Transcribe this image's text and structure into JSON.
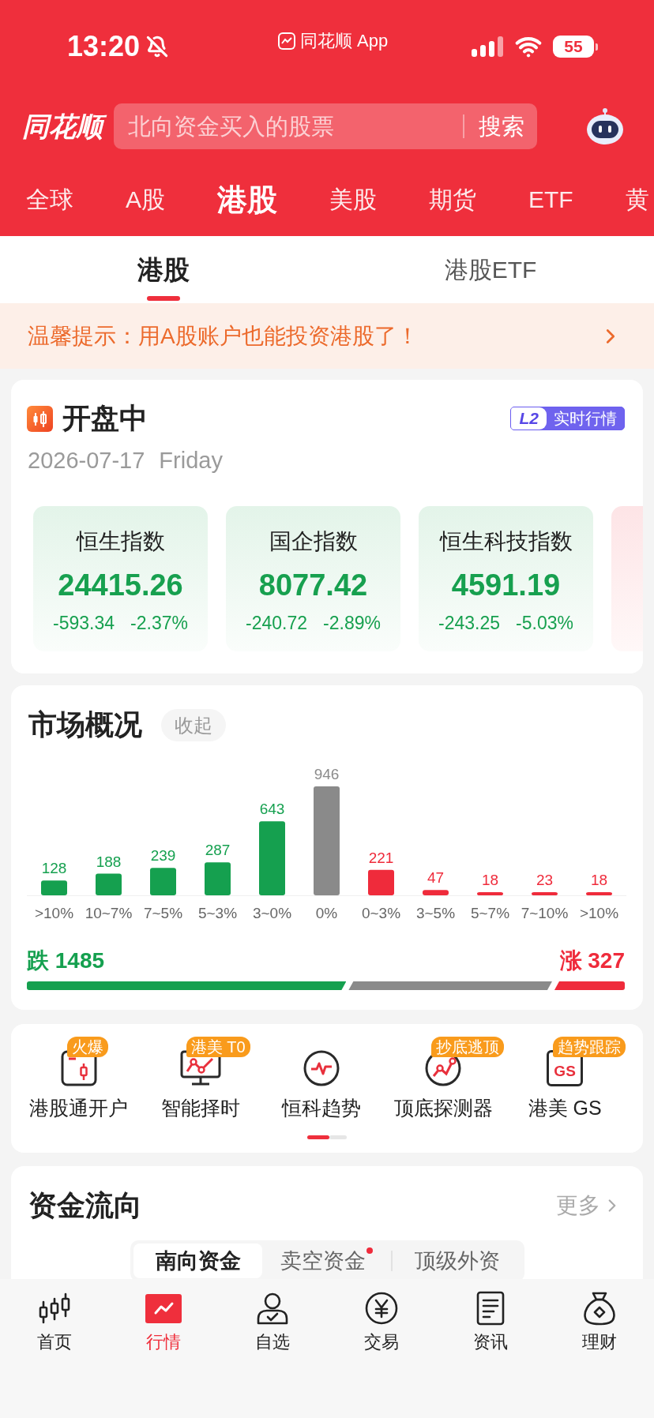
{
  "status_bar": {
    "time": "13:20",
    "app_name": "同花顺 App",
    "battery": "55"
  },
  "header": {
    "logo": "同花顺",
    "search": {
      "placeholder": "北向资金买入的股票",
      "button": "搜索"
    }
  },
  "market_tabs": [
    {
      "label": "全球",
      "selected": false
    },
    {
      "label": "A股",
      "selected": false
    },
    {
      "label": "港股",
      "selected": true
    },
    {
      "label": "美股",
      "selected": false
    },
    {
      "label": "期货",
      "selected": false
    },
    {
      "label": "ETF",
      "selected": false
    },
    {
      "label": "黄",
      "selected": false
    }
  ],
  "sub_tabs": [
    {
      "label": "港股",
      "selected": true
    },
    {
      "label": "港股ETF",
      "selected": false
    }
  ],
  "notice": {
    "text": "温馨提示：用A股账户也能投资港股了！"
  },
  "session": {
    "status": "开盘中",
    "date": "2026-07-17",
    "weekday": "Friday",
    "badge": {
      "tag": "L2",
      "label": "实时行情"
    }
  },
  "indices": [
    {
      "name": "恒生指数",
      "value": "24415.26",
      "change": "-593.34",
      "percent": "-2.37%",
      "kind": "down"
    },
    {
      "name": "国企指数",
      "value": "8077.42",
      "change": "-240.72",
      "percent": "-2.89%",
      "kind": "down"
    },
    {
      "name": "恒生科技指数",
      "value": "4591.19",
      "change": "-243.25",
      "percent": "-5.03%",
      "kind": "down"
    },
    {
      "kind": "up"
    }
  ],
  "market_overview": {
    "title": "市场概况",
    "toggle": "收起",
    "chart_data": {
      "type": "bar",
      "categories": [
        ">10%",
        "10~7%",
        "7~5%",
        "5~3%",
        "3~0%",
        "0%",
        "0~3%",
        "3~5%",
        "5~7%",
        "7~10%",
        ">10%"
      ],
      "series": [
        {
          "color": "#15a04f",
          "values": [
            128,
            188,
            239,
            287,
            643,
            null,
            null,
            null,
            null,
            null,
            null
          ]
        },
        {
          "color": "#8a8a8a",
          "values": [
            null,
            null,
            null,
            null,
            null,
            946,
            null,
            null,
            null,
            null,
            null
          ]
        },
        {
          "color": "#ef2b3b",
          "values": [
            null,
            null,
            null,
            null,
            null,
            null,
            221,
            47,
            18,
            23,
            18
          ]
        }
      ],
      "stacked": true,
      "data_labels": true
    },
    "decline": "跌 1485",
    "advance": "涨 327"
  },
  "tools": {
    "items": [
      {
        "label": "港股通开户",
        "badge": "火爆",
        "kind": "candle-card"
      },
      {
        "label": "智能择时",
        "badge": "港美 T0",
        "kind": "monitor-chart"
      },
      {
        "label": "恒科趋势",
        "kind": "pulse-circle"
      },
      {
        "label": "顶底探测器",
        "badge": "抄底逃顶",
        "kind": "trend-circle"
      },
      {
        "label": "港美 GS",
        "badge": "趋势跟踪",
        "kind": "letter-tile",
        "icon_text": "GS"
      }
    ],
    "pages": [
      {
        "selected": true
      },
      {
        "selected": false
      }
    ]
  },
  "fund_flow": {
    "title": "资金流向",
    "more": "更多",
    "tabs": [
      {
        "label": "南向资金",
        "selected": true,
        "dot": false
      },
      {
        "label": "卖空资金",
        "selected": false,
        "dot": true
      },
      {
        "label": "顶级外资",
        "selected": false,
        "dot": false
      }
    ]
  },
  "bottom_nav": [
    {
      "label": "首页",
      "kind": "home",
      "selected": false
    },
    {
      "label": "行情",
      "kind": "market",
      "selected": true
    },
    {
      "label": "自选",
      "kind": "watchlist",
      "selected": false
    },
    {
      "label": "交易",
      "kind": "trade",
      "selected": false
    },
    {
      "label": "资讯",
      "kind": "news",
      "selected": false
    },
    {
      "label": "理财",
      "kind": "wealth",
      "selected": false
    }
  ]
}
